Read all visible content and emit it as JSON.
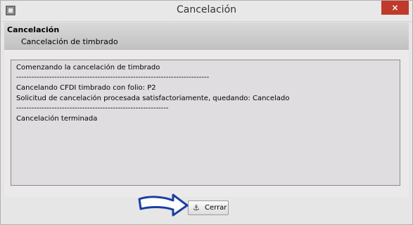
{
  "window": {
    "title": "Cancelación",
    "close_label": "×"
  },
  "header": {
    "title": "Cancelación",
    "subtitle": "Cancelación de timbrado"
  },
  "log": {
    "lines": [
      "Comenzando la cancelación de timbrado",
      "----------------------------------------------------------------------------",
      "Cancelando CFDI timbrado con folio: P2",
      "Solicitud de cancelación procesada satisfactoriamente, quedando: Cancelado",
      "------------------------------------------------------------",
      "Cancelación terminada"
    ]
  },
  "footer": {
    "close_button_label": "Cerrar",
    "close_button_icon": "anchor-icon"
  },
  "colors": {
    "close_accent": "#c0392b",
    "arrow_stroke": "#1a3fa1"
  }
}
